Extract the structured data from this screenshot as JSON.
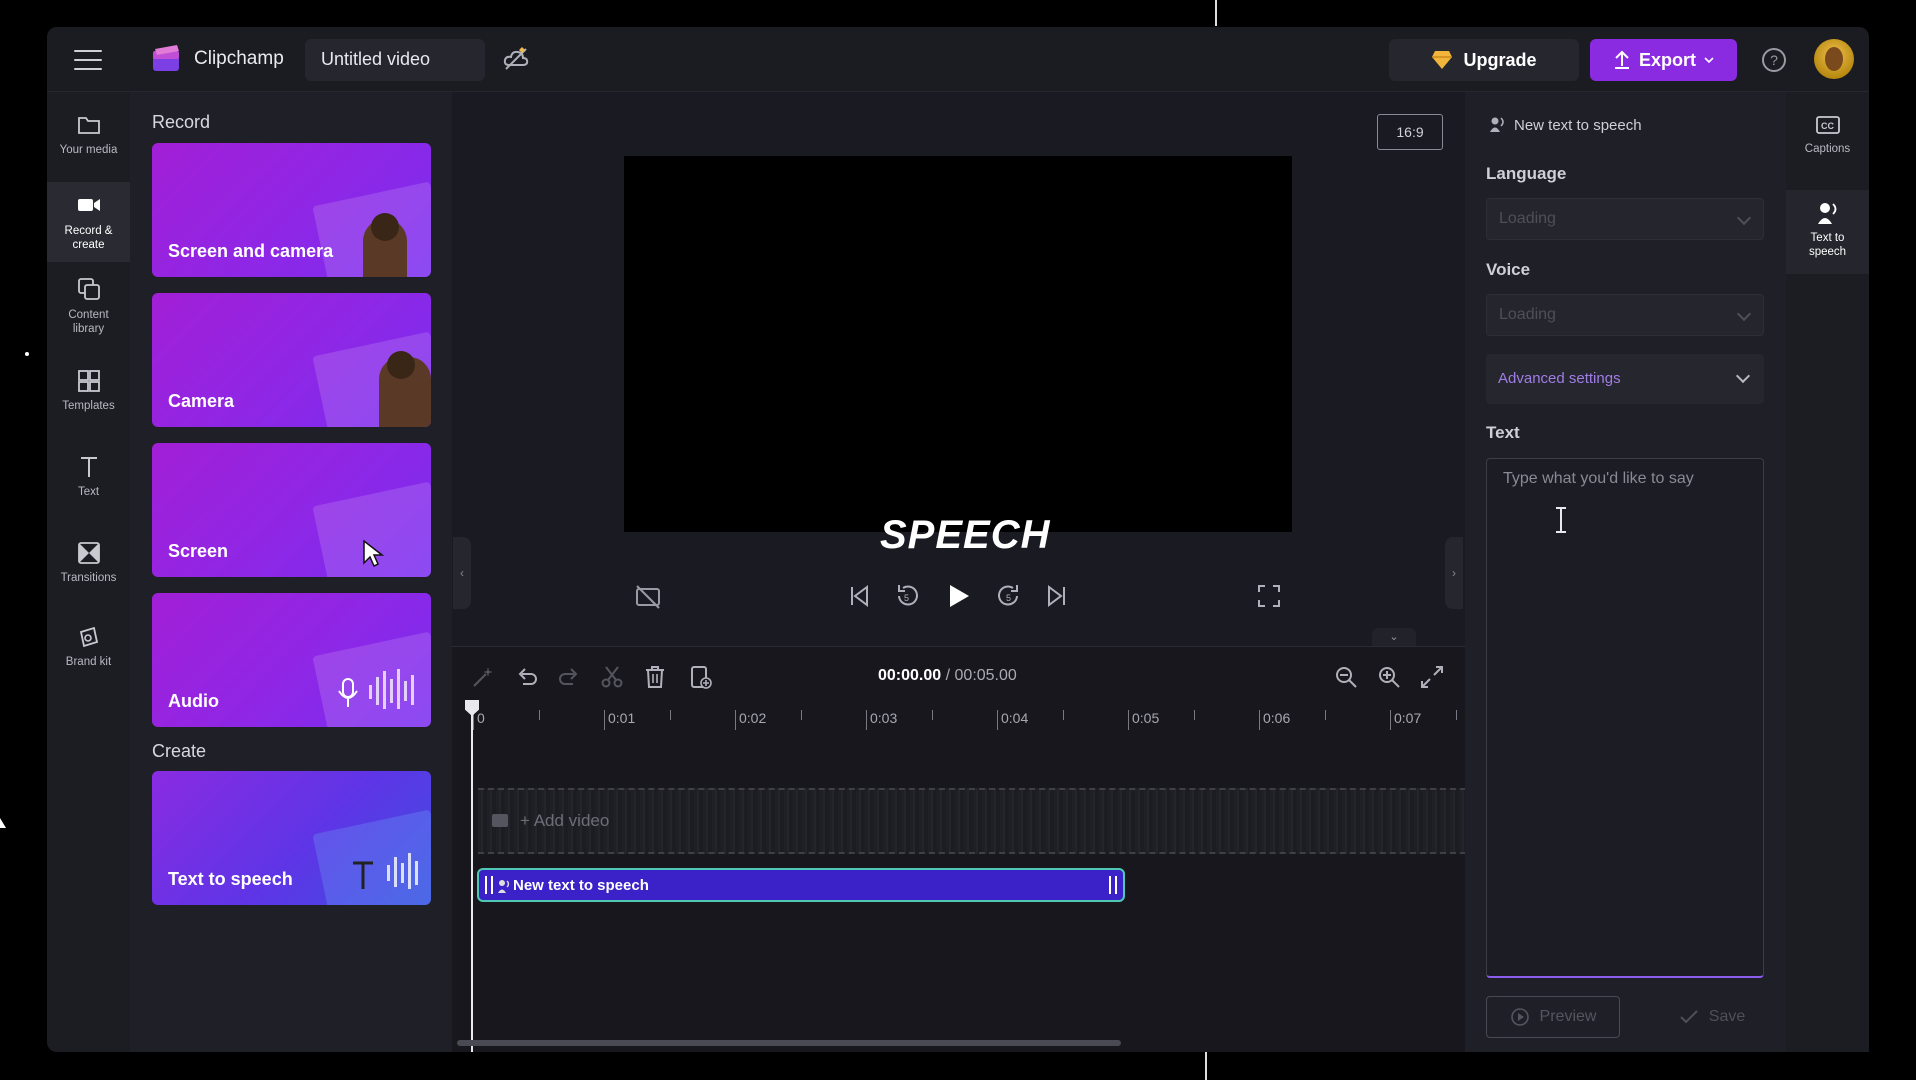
{
  "app": {
    "brand": "Clipchamp",
    "project_title": "Untitled video"
  },
  "topbar": {
    "upgrade_label": "Upgrade",
    "export_label": "Export",
    "help_label": "?"
  },
  "left_rail": {
    "items": [
      {
        "label": "Your media",
        "icon": "folder-icon"
      },
      {
        "label": "Record & create",
        "icon": "video-camera-icon"
      },
      {
        "label": "Content library",
        "icon": "library-icon"
      },
      {
        "label": "Templates",
        "icon": "templates-icon"
      },
      {
        "label": "Text",
        "icon": "text-icon"
      },
      {
        "label": "Transitions",
        "icon": "transitions-icon"
      },
      {
        "label": "Brand kit",
        "icon": "brand-kit-icon"
      }
    ]
  },
  "panel": {
    "record_heading": "Record",
    "create_heading": "Create",
    "cards": [
      {
        "label": "Screen and camera"
      },
      {
        "label": "Camera"
      },
      {
        "label": "Screen"
      },
      {
        "label": "Audio"
      },
      {
        "label": "Text to speech"
      }
    ]
  },
  "stage": {
    "aspect_ratio": "16:9",
    "caption_overlay": "SPEECH"
  },
  "timeline": {
    "current_time": "00:00.00",
    "total_time": "/ 00:05.00",
    "ruler_labels": [
      "0",
      "0:01",
      "0:02",
      "0:03",
      "0:04",
      "0:05",
      "0:06",
      "0:07"
    ],
    "add_video_label": "+ Add video",
    "clip_label": "New text to speech"
  },
  "properties": {
    "title": "New text to speech",
    "language_label": "Language",
    "language_value": "Loading",
    "voice_label": "Voice",
    "voice_value": "Loading",
    "advanced_label": "Advanced settings",
    "text_label": "Text",
    "text_placeholder": "Type what you'd like to say",
    "preview_label": "Preview",
    "save_label": "Save"
  },
  "right_rail": {
    "items": [
      {
        "label": "Captions",
        "icon": "captions-icon"
      },
      {
        "label": "Text to speech",
        "icon": "text-to-speech-icon"
      }
    ]
  },
  "colors": {
    "accent": "#8a2be2",
    "clip_fill": "#3a22c8",
    "clip_border": "#4fc9b4",
    "advanced_text": "#a07de6"
  }
}
